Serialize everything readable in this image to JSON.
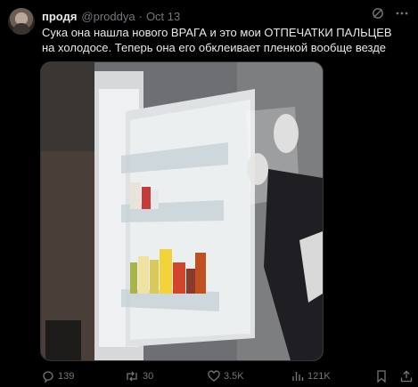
{
  "author": {
    "name": "продя",
    "handle": "@proddya",
    "separator": "·",
    "date": "Oct 13"
  },
  "tweet": {
    "text": "Сука она нашла нового ВРАГА и это мои ОТПЕЧАТКИ ПАЛЬЦЕВ на холодосе. Теперь она его обклеивает пленкой вообще везде"
  },
  "media": {
    "alt": "Open refrigerator door with person in gloves applying plastic film"
  },
  "actions": {
    "replies": "139",
    "reposts": "30",
    "likes": "3.5K",
    "views": "121K"
  },
  "icons": [
    "grok-icon",
    "more-icon",
    "reply-icon",
    "repost-icon",
    "like-icon",
    "views-icon",
    "bookmark-icon",
    "share-icon"
  ],
  "colors": {
    "background": "#000000",
    "text": "#e7e9ea",
    "muted": "#71767b"
  }
}
